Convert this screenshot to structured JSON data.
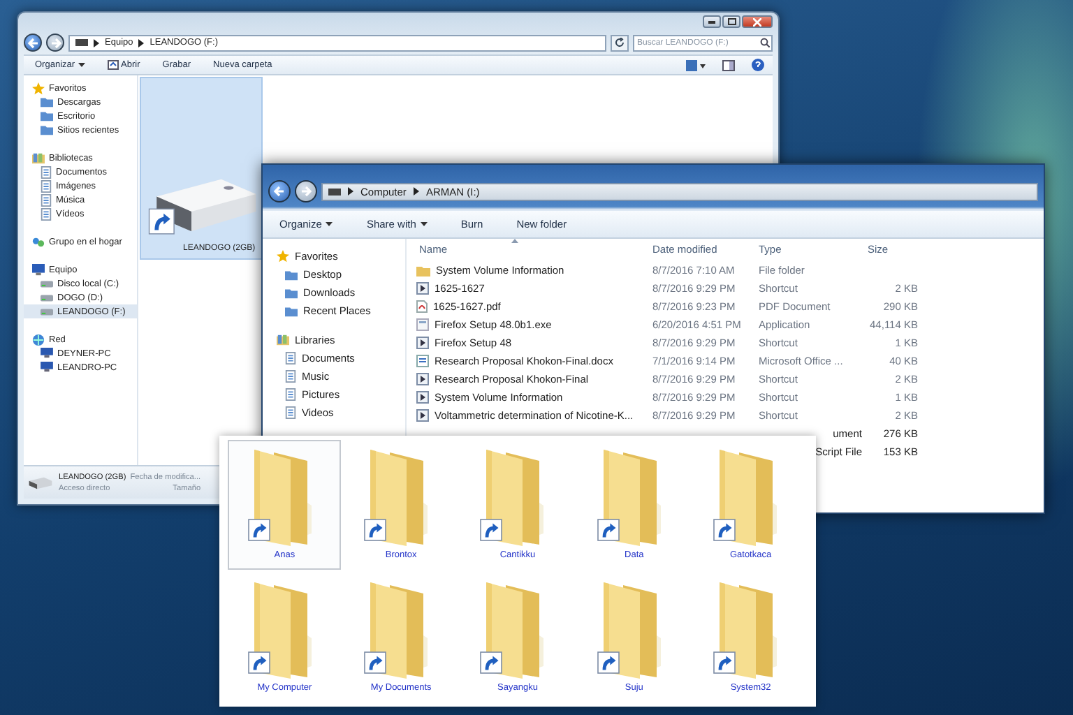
{
  "back_window": {
    "address": [
      {
        "label": "Equipo"
      },
      {
        "label": "LEANDOGO (F:)"
      }
    ],
    "search": {
      "placeholder": "Buscar LEANDOGO (F:)"
    },
    "toolbar": [
      {
        "label": "Organizar",
        "kind": "menu"
      },
      {
        "label": "Abrir",
        "kind": "open"
      },
      {
        "label": "Grabar",
        "kind": "plain"
      },
      {
        "label": "Nueva carpeta",
        "kind": "plain"
      }
    ],
    "sidebar": [
      {
        "label": "Favoritos",
        "kind": "favorites",
        "selected": false,
        "children": [
          {
            "label": "Descargas",
            "selected": false
          },
          {
            "label": "Escritorio",
            "selected": false
          },
          {
            "label": "Sitios recientes",
            "selected": false
          }
        ]
      },
      {
        "label": "Bibliotecas",
        "kind": "libraries",
        "selected": false,
        "children": [
          {
            "label": "Documentos",
            "selected": false
          },
          {
            "label": "Imágenes",
            "selected": false
          },
          {
            "label": "Música",
            "selected": false
          },
          {
            "label": "Vídeos",
            "selected": false
          }
        ]
      },
      {
        "label": "Grupo en el hogar",
        "kind": "homegroup",
        "selected": false
      },
      {
        "label": "Equipo",
        "kind": "computer",
        "selected": false,
        "children": [
          {
            "label": "Disco local (C:)",
            "selected": false
          },
          {
            "label": "DOGO (D:)",
            "selected": false
          },
          {
            "label": "LEANDOGO (F:)",
            "selected": true
          }
        ]
      },
      {
        "label": "Red",
        "kind": "network",
        "selected": false,
        "children": [
          {
            "label": "DEYNER-PC",
            "selected": false
          },
          {
            "label": "LEANDRO-PC",
            "selected": false
          }
        ]
      }
    ],
    "drive": {
      "label": "LEANDOGO (2GB)",
      "selected": true
    },
    "status_bar": {
      "name": "LEANDOGO (2GB)",
      "modified": "Fecha de modifica...",
      "type": "Acceso directo",
      "size": "Tamaño"
    }
  },
  "front_window": {
    "address": [
      {
        "label": "Computer"
      },
      {
        "label": "ARMAN (I:)"
      }
    ],
    "toolbar": [
      {
        "label": "Organize",
        "kind": "menu"
      },
      {
        "label": "Share with",
        "kind": "menu"
      },
      {
        "label": "Burn",
        "kind": "plain"
      },
      {
        "label": "New folder",
        "kind": "plain"
      }
    ],
    "sidebar": [
      {
        "label": "Favorites",
        "kind": "favorites",
        "selected": false,
        "children": [
          {
            "label": "Desktop",
            "selected": false
          },
          {
            "label": "Downloads",
            "selected": false
          },
          {
            "label": "Recent Places",
            "selected": false
          }
        ]
      },
      {
        "label": "Libraries",
        "kind": "libraries",
        "selected": false,
        "children": [
          {
            "label": "Documents",
            "selected": false
          },
          {
            "label": "Music",
            "selected": false
          },
          {
            "label": "Pictures",
            "selected": false
          },
          {
            "label": "Videos",
            "selected": false
          }
        ]
      }
    ],
    "columns": [
      {
        "label": "Name",
        "sorted": true
      },
      {
        "label": "Date modified",
        "sorted": false
      },
      {
        "label": "Type",
        "sorted": false
      },
      {
        "label": "Size",
        "sorted": false
      }
    ],
    "rows": [
      {
        "kind": "folder",
        "name": "System Volume Information",
        "date": "8/7/2016 7:10 AM",
        "type": "File folder"
      },
      {
        "kind": "shortcut",
        "name": "1625-1627",
        "date": "8/7/2016 9:29 PM",
        "type": "Shortcut",
        "size": "2 KB"
      },
      {
        "kind": "pdf",
        "name": "1625-1627.pdf",
        "date": "8/7/2016 9:23 PM",
        "type": "PDF Document",
        "size": "290 KB"
      },
      {
        "kind": "exe",
        "name": "Firefox Setup 48.0b1.exe",
        "date": "6/20/2016 4:51 PM",
        "type": "Application",
        "size": "44,114 KB"
      },
      {
        "kind": "shortcut",
        "name": "Firefox Setup 48",
        "date": "8/7/2016 9:29 PM",
        "type": "Shortcut",
        "size": "1 KB"
      },
      {
        "kind": "docx",
        "name": "Research Proposal Khokon-Final.docx",
        "date": "7/1/2016 9:14 PM",
        "type": "Microsoft Office ...",
        "size": "40 KB"
      },
      {
        "kind": "shortcut",
        "name": "Research Proposal Khokon-Final",
        "date": "8/7/2016 9:29 PM",
        "type": "Shortcut",
        "size": "2 KB"
      },
      {
        "kind": "shortcut",
        "name": "System Volume Information",
        "date": "8/7/2016 9:29 PM",
        "type": "Shortcut",
        "size": "1 KB"
      },
      {
        "kind": "shortcut",
        "name": "Voltammetric determination of Nicotine-K...",
        "date": "8/7/2016 9:29 PM",
        "type": "Shortcut",
        "size": "2 KB"
      },
      {
        "kind": "covered",
        "type": "ument",
        "size": "276 KB"
      },
      {
        "kind": "covered",
        "type": "Script File",
        "size": "153 KB"
      }
    ]
  },
  "folder_panel": {
    "folders": [
      {
        "label": "Anas",
        "selected": true
      },
      {
        "label": "Brontox",
        "selected": false
      },
      {
        "label": "Cantikku",
        "selected": false
      },
      {
        "label": "Data",
        "selected": false
      },
      {
        "label": "Gatotkaca",
        "selected": false
      },
      {
        "label": "My Computer",
        "selected": false
      },
      {
        "label": "My Documents",
        "selected": false
      },
      {
        "label": "Sayangku",
        "selected": false
      },
      {
        "label": "Suju",
        "selected": false
      },
      {
        "label": "System32",
        "selected": false
      }
    ]
  }
}
